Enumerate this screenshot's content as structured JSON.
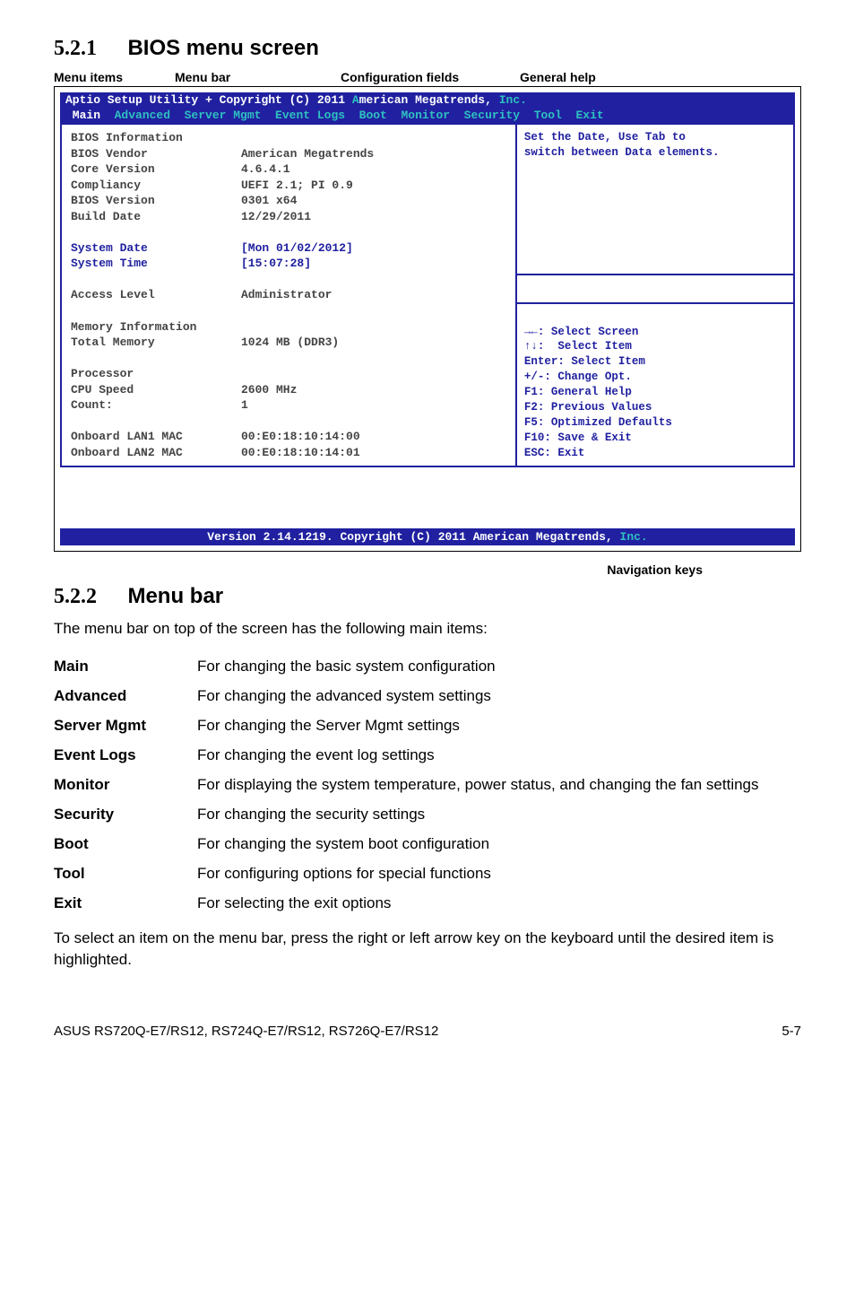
{
  "section1": {
    "num": "5.2.1",
    "title": "BIOS menu screen"
  },
  "callouts": {
    "menu_items": "Menu items",
    "menu_bar": "Menu bar",
    "config_fields": "Configuration fields",
    "general_help": "General help",
    "nav_keys": "Navigation keys"
  },
  "bios": {
    "header_left": "Aptio Setup Utility ",
    "header_plus": "+",
    "header_mid": " Copyright (C) 2011 ",
    "header_a": "A",
    "header_right": "merican Megatrends, ",
    "header_inc": "Inc.",
    "menubar": {
      "main": " Main ",
      "rest": " Advanced  Server Mgmt  Event Logs  Boot  Monitor  Security  Tool  Exit "
    },
    "left": {
      "r1": {
        "label": "BIOS Information",
        "val": ""
      },
      "r2": {
        "label": "BIOS Vendor",
        "val": "American Megatrends"
      },
      "r3": {
        "label": "Core Version",
        "val": "4.6.4.1"
      },
      "r4": {
        "label": "Compliancy",
        "val": "UEFI 2.1; PI 0.9"
      },
      "r5": {
        "label": "BIOS Version",
        "val": "0301 x64"
      },
      "r6": {
        "label": "Build Date",
        "val": "12/29/2011"
      },
      "s1": {
        "label": "System Date",
        "val": "[Mon 01/02/2012]"
      },
      "s2": {
        "label": "System Time",
        "val": "[15:07:28]"
      },
      "a1": {
        "label": "Access Level",
        "val": "Administrator"
      },
      "m1": {
        "label": "Memory Information",
        "val": ""
      },
      "m2": {
        "label": "Total Memory",
        "val": "1024 MB (DDR3)"
      },
      "p1": {
        "label": "Processor",
        "val": ""
      },
      "p2": {
        "label": "CPU Speed",
        "val": "2600 MHz"
      },
      "p3": {
        "label": "Count:",
        "val": "1"
      },
      "l1": {
        "label": "Onboard LAN1 MAC",
        "val": "00:E0:18:10:14:00"
      },
      "l2": {
        "label": "Onboard LAN2 MAC",
        "val": "00:E0:18:10:14:01"
      }
    },
    "right_top": {
      "line1": "Set the Date, Use Tab to",
      "line2": "switch between Data elements."
    },
    "right_bot": {
      "l1": "→←: Select Screen",
      "l2": "↑↓:  Select Item",
      "l3": "Enter: Select Item",
      "l4": "+/-: Change Opt.",
      "l5": "F1: General Help",
      "l6": "F2: Previous Values",
      "l7": "F5: Optimized Defaults",
      "l8": "F10: Save & Exit",
      "l9": "ESC: Exit"
    },
    "footer_left": "Version 2.14.1219. Copyright (C) 2011 American Megatrends, ",
    "footer_inc": "Inc."
  },
  "section2": {
    "num": "5.2.2",
    "title": "Menu bar"
  },
  "para1": "The menu bar on top of the screen has the following main items:",
  "menu_table": [
    {
      "name": "Main",
      "desc": "For changing the basic system configuration"
    },
    {
      "name": "Advanced",
      "desc": "For changing the advanced system settings"
    },
    {
      "name": "Server Mgmt",
      "desc": "For changing the Server Mgmt settings"
    },
    {
      "name": "Event Logs",
      "desc": "For changing the event log settings"
    },
    {
      "name": "Monitor",
      "desc": "For displaying the system temperature, power status, and changing the fan settings"
    },
    {
      "name": "Security",
      "desc": "For changing the security settings"
    },
    {
      "name": "Boot",
      "desc": "For changing the system boot configuration"
    },
    {
      "name": "Tool",
      "desc": "For configuring options for special functions"
    },
    {
      "name": "Exit",
      "desc": "For selecting the exit options"
    }
  ],
  "para2": "To select an item on the menu bar, press the right or left arrow key on the keyboard until the desired item is highlighted.",
  "footer": {
    "left": "ASUS RS720Q-E7/RS12, RS724Q-E7/RS12, RS726Q-E7/RS12",
    "right": "5-7"
  }
}
